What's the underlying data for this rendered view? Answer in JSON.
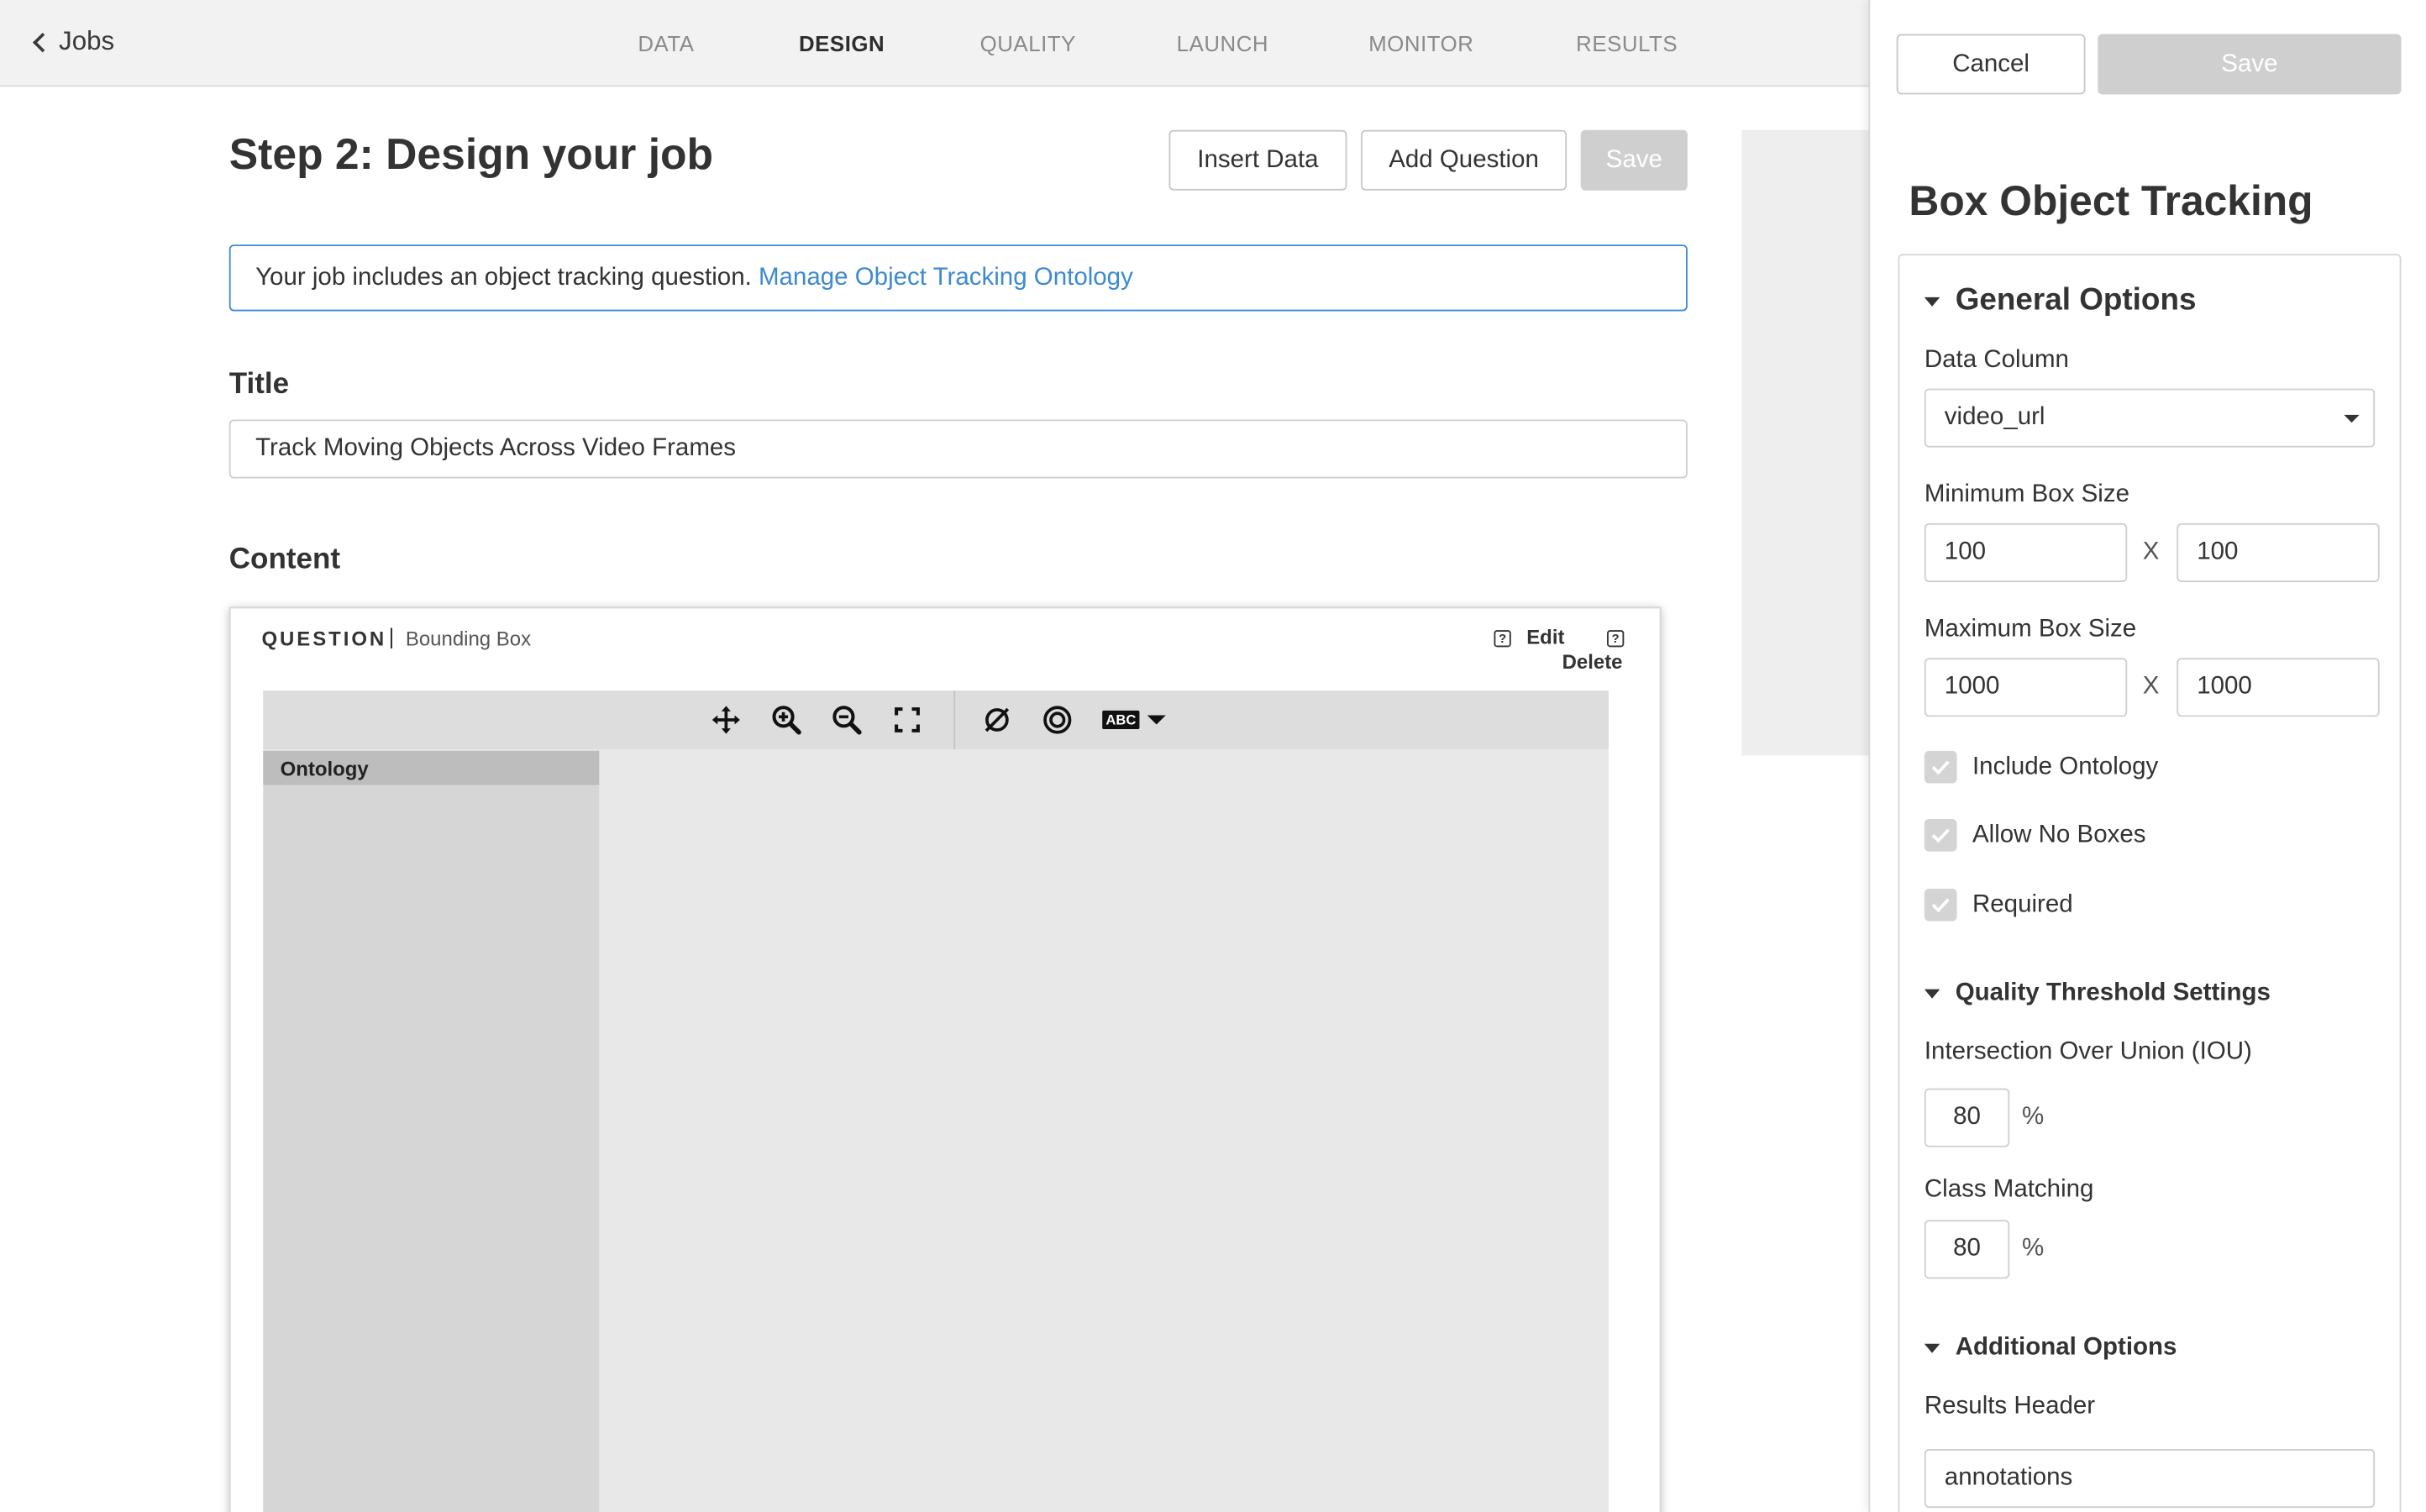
{
  "nav": {
    "back_label": "Jobs",
    "tabs": [
      {
        "label": "DATA",
        "active": false
      },
      {
        "label": "DESIGN",
        "active": true
      },
      {
        "label": "QUALITY",
        "active": false
      },
      {
        "label": "LAUNCH",
        "active": false
      },
      {
        "label": "MONITOR",
        "active": false
      },
      {
        "label": "RESULTS",
        "active": false
      }
    ]
  },
  "main": {
    "title": "Step 2: Design your job",
    "buttons": {
      "insert_data": "Insert Data",
      "add_question": "Add Question",
      "save": "Save"
    },
    "notice": {
      "text": "Your job includes an object tracking question. ",
      "link": "Manage Object Tracking Ontology"
    },
    "title_label": "Title",
    "title_value": "Track Moving Objects Across Video Frames",
    "content_label": "Content",
    "question": {
      "label": "QUESTION",
      "separator": "|",
      "type": "Bounding Box",
      "edit": "Edit",
      "delete": "Delete",
      "help_glyph": "?",
      "toolbar_icons": [
        "move-icon",
        "zoom-in-icon",
        "zoom-out-icon",
        "fullscreen-icon",
        "hide-icon",
        "target-icon",
        "label-toggle-icon"
      ],
      "label_badge": "ABC",
      "ontology_header": "Ontology"
    }
  },
  "sidebar": {
    "cancel": "Cancel",
    "save": "Save",
    "title": "Box Object Tracking",
    "general_options": {
      "heading": "General Options",
      "data_column_label": "Data Column",
      "data_column_value": "video_url",
      "min_box_label": "Minimum Box Size",
      "min_w": "100",
      "min_h": "100",
      "max_box_label": "Maximum Box Size",
      "max_w": "1000",
      "max_h": "1000",
      "x_sep": "X",
      "include_ontology": "Include Ontology",
      "allow_no_boxes": "Allow No Boxes",
      "required": "Required"
    },
    "quality": {
      "heading": "Quality Threshold Settings",
      "iou_label": "Intersection Over Union (IOU)",
      "iou_value": "80",
      "class_label": "Class Matching",
      "class_value": "80",
      "pct": "%"
    },
    "additional": {
      "heading": "Additional Options",
      "results_header_label": "Results Header",
      "results_header_value": "annotations"
    }
  },
  "colors": {
    "accent": "#3d8ad1",
    "disabled": "#cfcfcf",
    "nav_bg": "#f2f2f2"
  }
}
